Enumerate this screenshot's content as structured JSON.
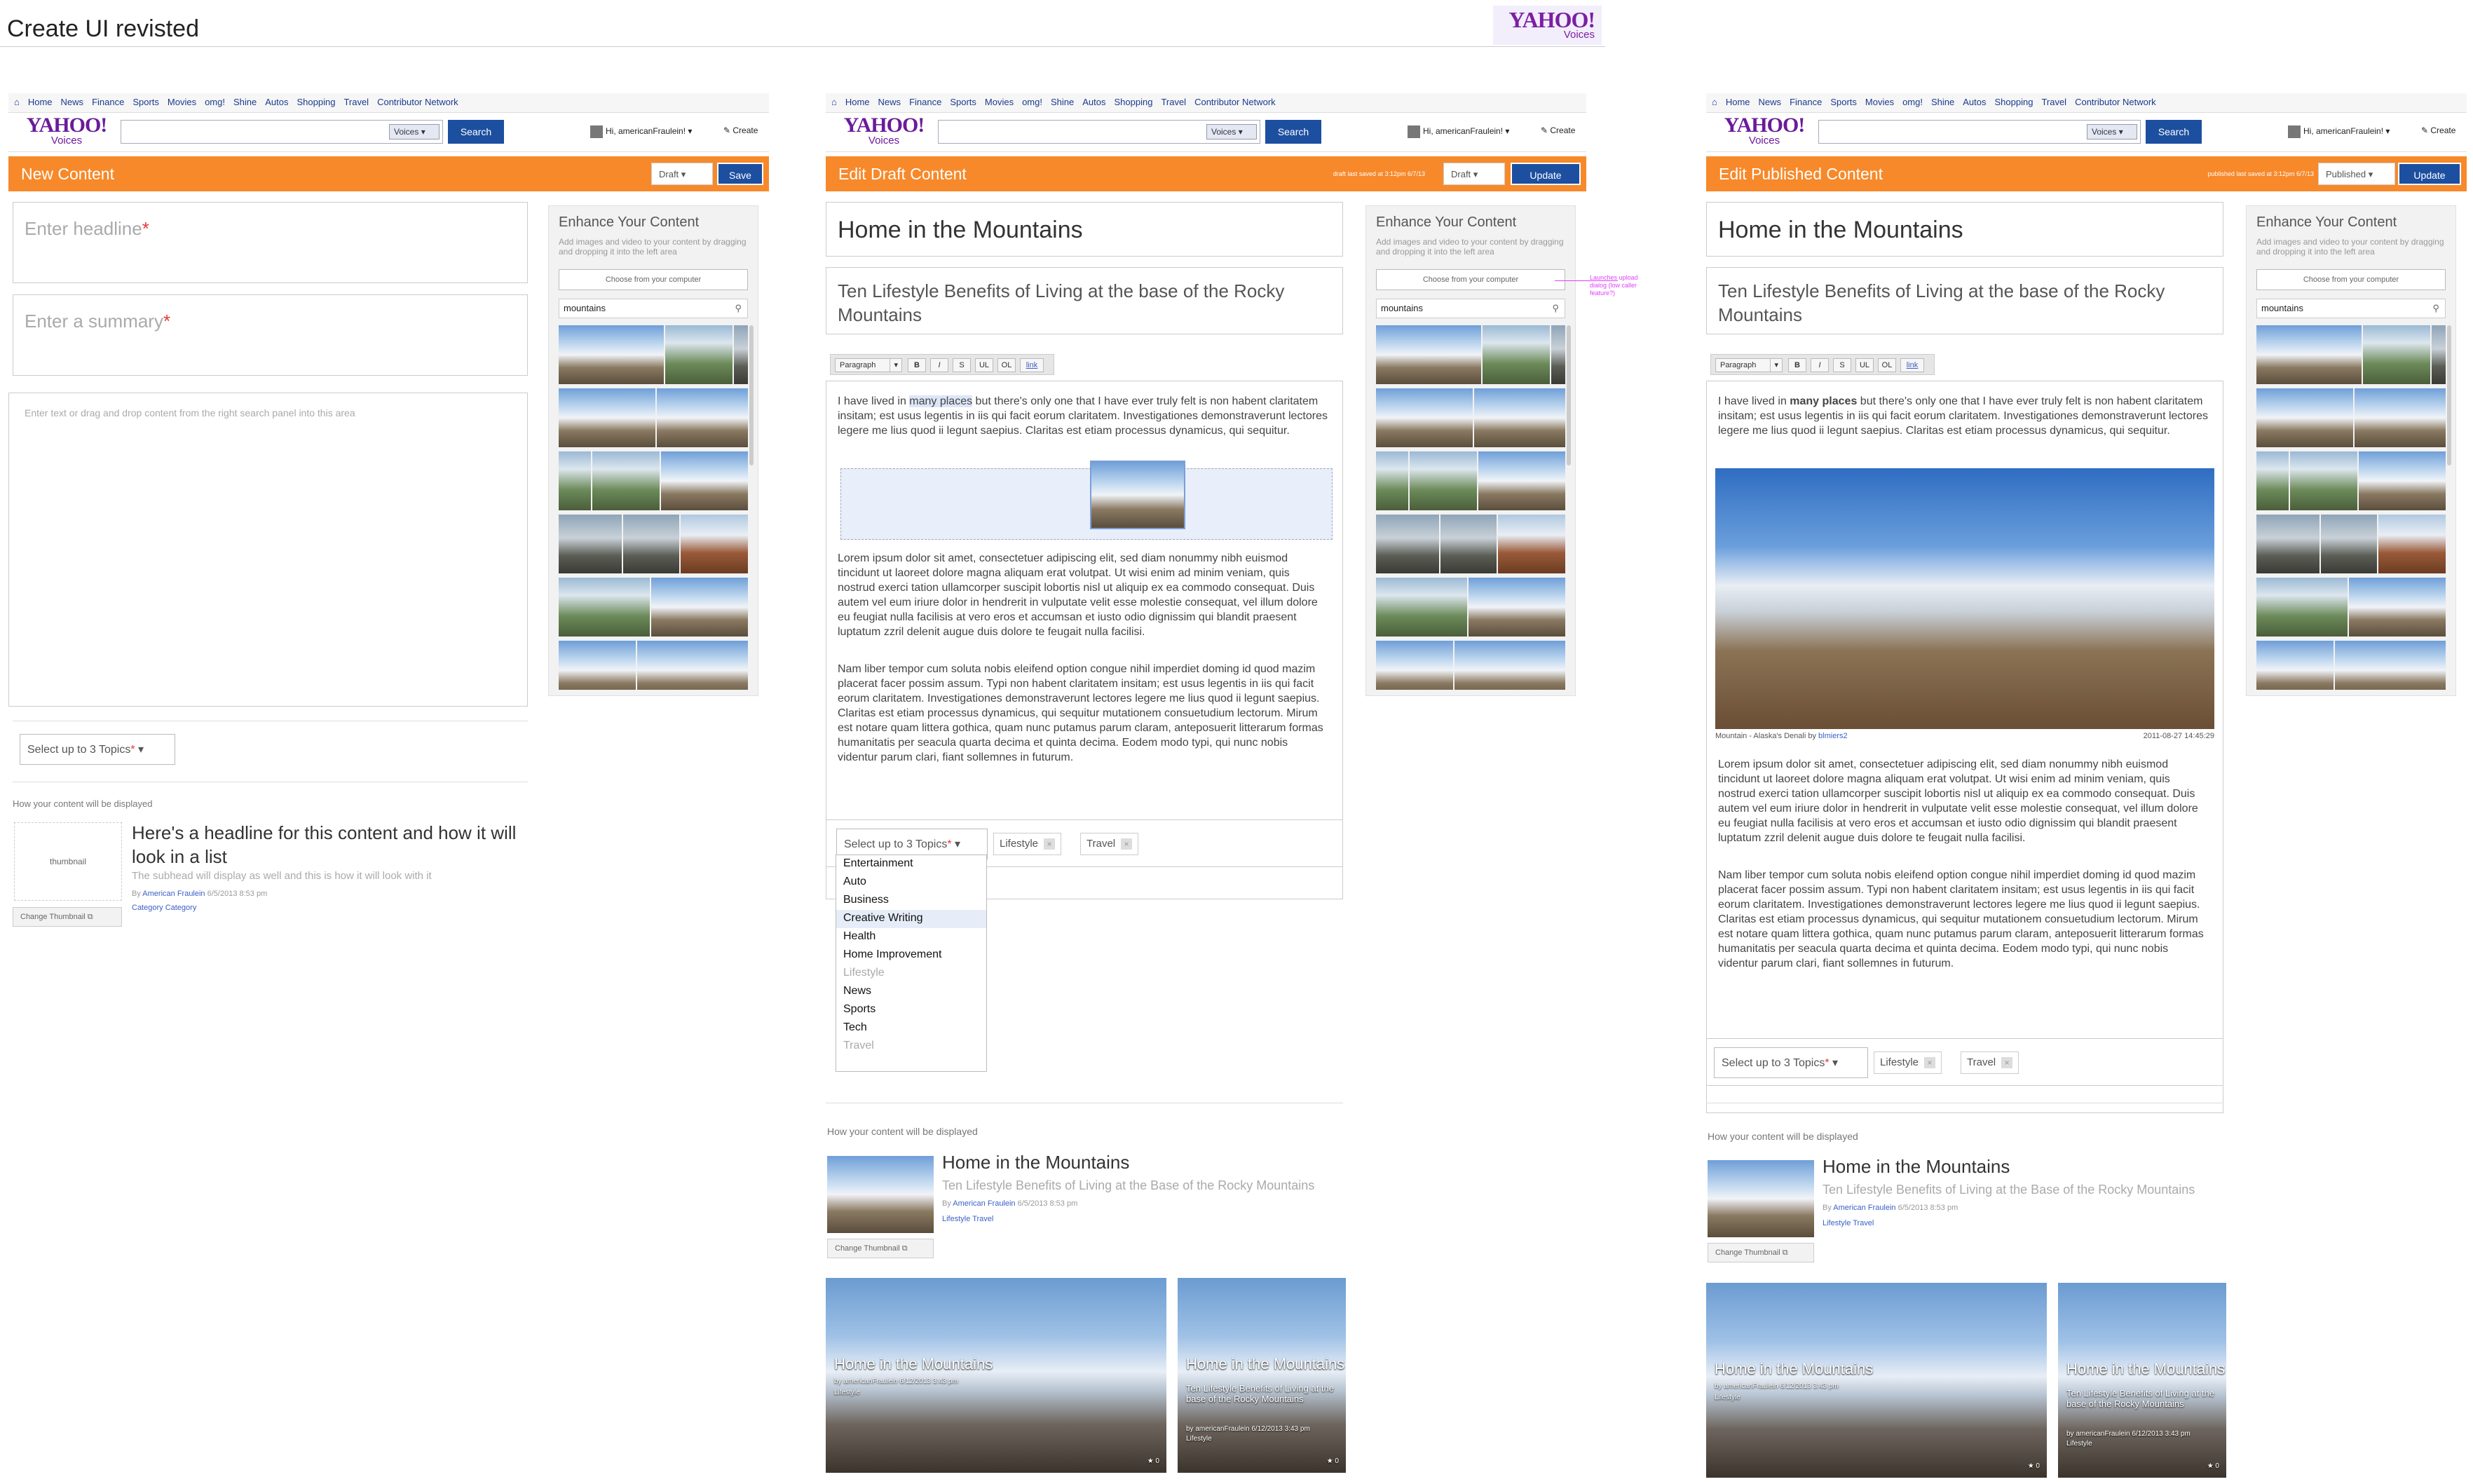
{
  "page_title": "Create UI revisted",
  "brand": {
    "yahoo": "YAHOO!",
    "voices": "Voices"
  },
  "nav": [
    "Home",
    "News",
    "Finance",
    "Sports",
    "Movies",
    "omg!",
    "Shine",
    "Autos",
    "Shopping",
    "Travel",
    "Contributor Network"
  ],
  "search": {
    "scope": "Voices",
    "button": "Search"
  },
  "user": "Hi, americanFraulein!",
  "create_link": "Create",
  "enhance": {
    "title": "Enhance Your Content",
    "desc": "Add images and video to your content by dragging and dropping it into the left area",
    "choose": "Choose from your computer",
    "query": "mountains"
  },
  "panel1": {
    "bar_title": "New Content",
    "status": "Draft",
    "action": "Save",
    "headline_placeholder": "Enter headline",
    "summary_placeholder": "Enter a summary",
    "body_placeholder": "Enter text or drag and drop content from the right search panel into this area",
    "topics_placeholder": "Select up to 3 Topics",
    "preview_label": "How your content will be displayed",
    "thumb_label": "thumbnail",
    "preview_headline": "Here's a headline for this content and how it will look in a list",
    "preview_sub": "The subhead will display as well and this is how it will look with it",
    "byline_by": "By",
    "byline_author": "American Fraulein",
    "byline_date": "6/5/2013 8:53 pm",
    "categories": "Category  Category",
    "change_thumb": "Change Thumbnail"
  },
  "panel2": {
    "bar_title": "Edit Draft Content",
    "save_status": "draft last saved at 3:12pm 6/7/13",
    "status": "Draft",
    "action": "Update",
    "headline": "Home in the Mountains",
    "summary": "Ten Lifestyle Benefits of Living at the base of the Rocky Mountains",
    "para_style": "Paragraph",
    "tools": [
      "B",
      "I",
      "S",
      "UL",
      "OL",
      "link"
    ],
    "p1_a": "I have lived in ",
    "p1_b": "many places",
    "p1_c": " but there's only one that I have ever truly felt is non habent claritatem insitam; est usus legentis in iis qui facit eorum claritatem. Investigationes demonstraverunt lectores legere me lius quod ii legunt saepius. Claritas est etiam processus dynamicus, qui sequitur.",
    "p2": "Lorem ipsum dolor sit amet, consectetuer adipiscing elit, sed diam nonummy nibh euismod tincidunt ut laoreet dolore magna aliquam erat volutpat. Ut wisi enim ad minim veniam, quis nostrud exerci tation ullamcorper suscipit lobortis nisl ut aliquip ex ea commodo consequat. Duis autem vel eum iriure dolor in hendrerit in vulputate velit esse molestie consequat, vel illum dolore eu feugiat nulla facilisis at vero eros et accumsan et iusto odio dignissim qui blandit praesent luptatum zzril delenit augue duis dolore te feugait nulla facilisi.",
    "p3": "Nam liber tempor cum soluta nobis eleifend option congue nihil imperdiet doming id quod mazim placerat facer possim assum. Typi non habent claritatem insitam; est usus legentis in iis qui facit eorum claritatem. Investigationes demonstraverunt lectores legere me lius quod ii legunt saepius. Claritas est etiam processus dynamicus, qui sequitur mutationem consuetudium lectorum. Mirum est notare quam littera gothica, quam nunc putamus parum claram, anteposuerit litterarum formas humanitatis per seacula quarta decima et quinta decima. Eodem modo typi, qui nunc nobis videntur parum clari, fiant sollemnes in futurum.",
    "topics_placeholder": "Select up to 3 Topics",
    "chips": [
      "Lifestyle",
      "Travel"
    ],
    "topics": [
      "Entertainment",
      "Auto",
      "Business",
      "Creative Writing",
      "Health",
      "Home Improvement",
      "Lifestyle",
      "News",
      "Sports",
      "Tech",
      "Travel"
    ],
    "annotation": "Launches upload dialog (low caller feature?)",
    "preview_label": "How your content will be displayed",
    "preview_headline": "Home in the Mountains",
    "preview_sub": "Ten Lifestyle Benefits of Living at the Base of the Rocky Mountains",
    "byline_by": "By",
    "byline_author": "American Fraulein",
    "byline_date": "6/5/2013 8:53 pm",
    "categories": "Lifestyle  Travel",
    "change_thumb": "Change Thumbnail",
    "card_title": "Home in the Mountains",
    "card_meta": "by americanFraulein  6/12/2013 3:43 pm",
    "card_cat": "Lifestyle",
    "card_sub": "Ten Lifestyle Benefits of Living at the base of the Rocky Mountains",
    "card_likes": "★ 0"
  },
  "panel3": {
    "bar_title": "Edit Published Content",
    "save_status": "published last saved at 3:12pm 6/7/13",
    "status": "Published",
    "action": "Update",
    "headline": "Home in the Mountains",
    "summary": "Ten Lifestyle Benefits of Living at the base of the Rocky Mountains",
    "caption_left": "Mountain - Alaska's Denali",
    "caption_by": "by",
    "caption_author": "blmiers2",
    "caption_date": "2011-08-27 14:45:29",
    "p1_a": "I have lived in ",
    "p1_b": "many places",
    "p1_c": " but there's only one that I have ever truly felt is non habent claritatem insitam; est usus legentis in iis qui facit eorum claritatem. Investigationes demonstraverunt lectores legere me lius quod ii legunt saepius. Claritas est etiam processus dynamicus, qui sequitur."
  },
  "colors": {
    "orange": "#f7892a",
    "blue": "#1d4fa0",
    "purple": "#6a1b9a",
    "annotation": "#e040fb"
  }
}
